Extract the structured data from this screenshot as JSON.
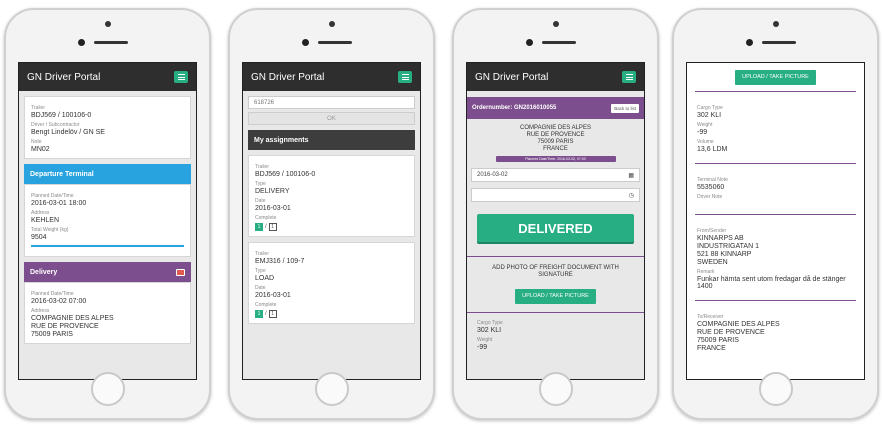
{
  "app": {
    "title": "GN Driver Portal"
  },
  "colors": {
    "accent_green": "#27ae83",
    "purple": "#7d4e8e",
    "blue": "#29a3e0",
    "navbar": "#2e2e2e"
  },
  "icons": {
    "menu": "hamburger-menu-icon",
    "image": "image-icon",
    "calendar": "calendar-icon",
    "clock": "clock-icon"
  },
  "screen1": {
    "trailer_label": "Trailer",
    "trailer_value": "BDJ569 / 100106-0",
    "driver_label": "Driver / Subcontractor",
    "driver_value": "Bengt Lindelöv / GN SE",
    "note_label": "Note",
    "note_value": "MN02",
    "departure_title": "Departure Terminal",
    "planned_label": "Planned Date/Time",
    "planned_value": "2016-03-01 18:00",
    "address_label": "Address",
    "address_value": "KEHLEN",
    "weight_label": "Total Weight (kg)",
    "weight_value": "9504",
    "delivery_title": "Delivery",
    "d_planned_label": "Planned Date/Time",
    "d_planned_value": "2016-03-02 07:00",
    "d_address_label": "Address",
    "d_address_lines": [
      "COMPAGNIE DES ALPES",
      "RUE DE PROVENCE",
      "75009 PARIS"
    ]
  },
  "screen2": {
    "search_value": "618726",
    "ok_label": "OK",
    "assignments_title": "My assignments",
    "assignments": [
      {
        "trailer_label": "Trailer",
        "trailer": "BDJ569 / 100106-0",
        "type_label": "Type",
        "type": "DELIVERY",
        "date_label": "Date",
        "date": "2016-03-01",
        "complete_label": "Complete",
        "done": "1",
        "sep": "/",
        "total": "1"
      },
      {
        "trailer_label": "Trailer",
        "trailer": "EMJ316 / 109-7",
        "type_label": "Type",
        "type": "LOAD",
        "date_label": "Date",
        "date": "2016-03-01",
        "complete_label": "Complete",
        "done": "1",
        "sep": "/",
        "total": "1"
      }
    ]
  },
  "screen3": {
    "order_label": "Ordernumber: GN2016010055",
    "back_label": "Back to list",
    "address_lines": [
      "COMPAGNIE DES ALPES",
      "RUE DE PROVENCE",
      "75009 PARIS",
      "FRANCE"
    ],
    "planned_tag": "Planned Date/Time: 2016-03-02, 07:00",
    "date_value": "2016-03-02",
    "time_value": "",
    "delivered_label": "DELIVERED",
    "add_photo_text": "ADD PHOTO OF FREIGHT DOCUMENT WITH SIGNATURE",
    "upload_label": "UPLOAD / TAKE PICTURE",
    "cargo_label": "Cargo Type",
    "cargo_value": "302 KLI",
    "weight_label": "Weight",
    "weight_value": "-99"
  },
  "screen4": {
    "upload_label": "UPLOAD / TAKE PICTURE",
    "cargo_label": "Cargo Type",
    "cargo_value": "302 KLI",
    "weight_label": "Weight",
    "weight_value": "-99",
    "volume_label": "Volume",
    "volume_value": "13,6 LDM",
    "terminal_note_label": "Terminal Note",
    "terminal_note_value": "5535060",
    "driver_note_label": "Driver Note",
    "from_label": "From/Sender",
    "from_lines": [
      "KINNARPS AB",
      "INDUSTRIGATAN 1",
      "521 88 KINNARP",
      "SWEDEN"
    ],
    "remark_label": "Remark",
    "remark_value": "Funkar hämta sent utom fredagar då de stänger 1400",
    "to_label": "To/Receiver",
    "to_lines": [
      "COMPAGNIE DES ALPES",
      "RUE DE PROVENCE",
      "75009 PARIS",
      "FRANCE"
    ]
  }
}
